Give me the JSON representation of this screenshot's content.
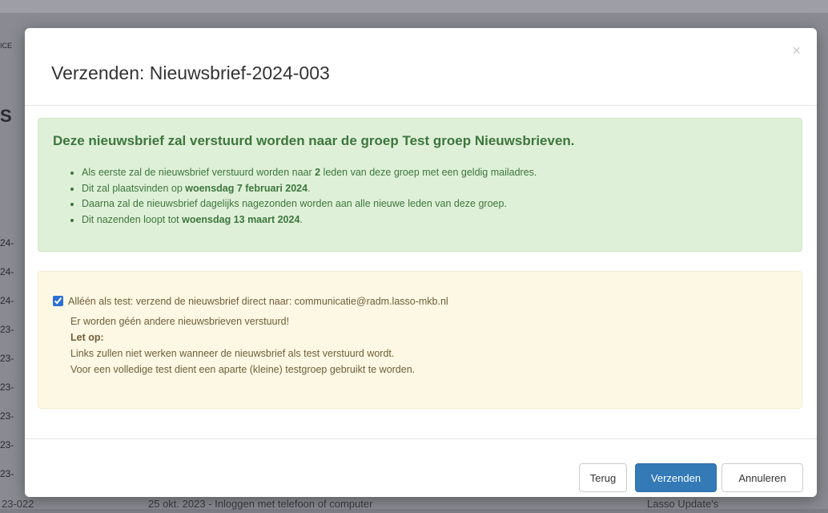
{
  "background": {
    "top_left_fragment": "ICE",
    "left_heading_fragment": "S",
    "left_rows": [
      "24-",
      "24-",
      "24-",
      "23-",
      "23-",
      "23-",
      "23-",
      "23-",
      "23-"
    ],
    "bottom_row": {
      "id": "23-022",
      "text": "25 okt. 2023 - Inloggen met telefoon of computer",
      "category": "Lasso Update's"
    }
  },
  "modal": {
    "title": "Verzenden: Nieuwsbrief-2024-003",
    "close_symbol": "×",
    "success": {
      "title_prefix": "Deze nieuwsbrief zal verstuurd worden naar de groep ",
      "group_name": "Test groep Nieuwsbrieven.",
      "items": [
        {
          "pre": "Als eerste zal de nieuwsbrief verstuurd worden naar ",
          "bold": "2",
          "post": " leden van deze groep met een geldig mailadres."
        },
        {
          "pre": "Dit zal plaatsvinden op ",
          "bold": "woensdag 7 februari 2024",
          "post": "."
        },
        {
          "pre": "Daarna zal de nieuwsbrief dagelijks nagezonden worden aan alle nieuwe leden van deze groep.",
          "bold": "",
          "post": ""
        },
        {
          "pre": "Dit nazenden loopt tot ",
          "bold": "woensdag 13 maart 2024",
          "post": "."
        }
      ]
    },
    "warning": {
      "checkbox_checked": true,
      "checkbox_label": "Alléén als test: verzend de nieuwsbrief direct naar: communicatie@radm.lasso-mkb.nl",
      "line2": "Er worden géén andere nieuwsbrieven verstuurd!",
      "note_title": "Let op:",
      "line4": "Links zullen niet werken wanneer de nieuwsbrief als test verstuurd wordt.",
      "line5": "Voor een volledige test dient een aparte (kleine) testgroep gebruikt te worden."
    },
    "buttons": {
      "back": "Terug",
      "send": "Verzenden",
      "cancel": "Annuleren"
    }
  },
  "colors": {
    "primary": "#337ab7",
    "success_bg": "#dff0d8",
    "success_text": "#3c763d",
    "warning_bg": "#fcf8e3"
  }
}
